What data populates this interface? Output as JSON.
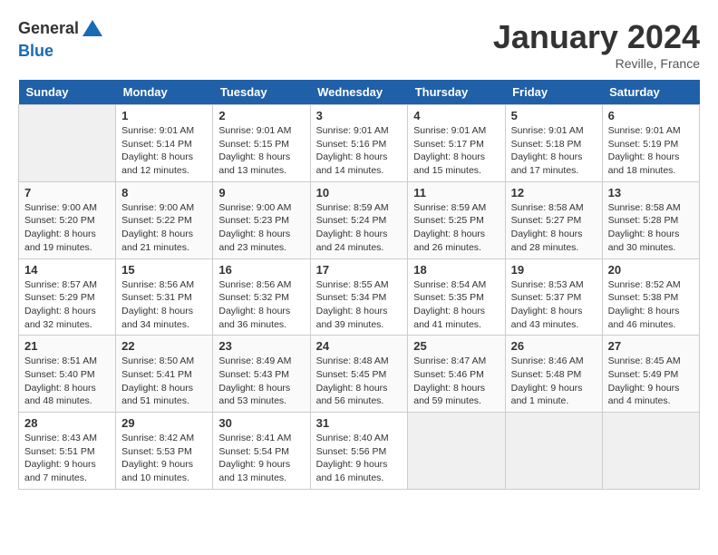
{
  "header": {
    "logo_general": "General",
    "logo_blue": "Blue",
    "month": "January 2024",
    "location": "Reville, France"
  },
  "weekdays": [
    "Sunday",
    "Monday",
    "Tuesday",
    "Wednesday",
    "Thursday",
    "Friday",
    "Saturday"
  ],
  "weeks": [
    [
      {
        "day": "",
        "empty": true
      },
      {
        "day": "1",
        "sunrise": "Sunrise: 9:01 AM",
        "sunset": "Sunset: 5:14 PM",
        "daylight": "Daylight: 8 hours and 12 minutes."
      },
      {
        "day": "2",
        "sunrise": "Sunrise: 9:01 AM",
        "sunset": "Sunset: 5:15 PM",
        "daylight": "Daylight: 8 hours and 13 minutes."
      },
      {
        "day": "3",
        "sunrise": "Sunrise: 9:01 AM",
        "sunset": "Sunset: 5:16 PM",
        "daylight": "Daylight: 8 hours and 14 minutes."
      },
      {
        "day": "4",
        "sunrise": "Sunrise: 9:01 AM",
        "sunset": "Sunset: 5:17 PM",
        "daylight": "Daylight: 8 hours and 15 minutes."
      },
      {
        "day": "5",
        "sunrise": "Sunrise: 9:01 AM",
        "sunset": "Sunset: 5:18 PM",
        "daylight": "Daylight: 8 hours and 17 minutes."
      },
      {
        "day": "6",
        "sunrise": "Sunrise: 9:01 AM",
        "sunset": "Sunset: 5:19 PM",
        "daylight": "Daylight: 8 hours and 18 minutes."
      }
    ],
    [
      {
        "day": "7",
        "sunrise": "Sunrise: 9:00 AM",
        "sunset": "Sunset: 5:20 PM",
        "daylight": "Daylight: 8 hours and 19 minutes."
      },
      {
        "day": "8",
        "sunrise": "Sunrise: 9:00 AM",
        "sunset": "Sunset: 5:22 PM",
        "daylight": "Daylight: 8 hours and 21 minutes."
      },
      {
        "day": "9",
        "sunrise": "Sunrise: 9:00 AM",
        "sunset": "Sunset: 5:23 PM",
        "daylight": "Daylight: 8 hours and 23 minutes."
      },
      {
        "day": "10",
        "sunrise": "Sunrise: 8:59 AM",
        "sunset": "Sunset: 5:24 PM",
        "daylight": "Daylight: 8 hours and 24 minutes."
      },
      {
        "day": "11",
        "sunrise": "Sunrise: 8:59 AM",
        "sunset": "Sunset: 5:25 PM",
        "daylight": "Daylight: 8 hours and 26 minutes."
      },
      {
        "day": "12",
        "sunrise": "Sunrise: 8:58 AM",
        "sunset": "Sunset: 5:27 PM",
        "daylight": "Daylight: 8 hours and 28 minutes."
      },
      {
        "day": "13",
        "sunrise": "Sunrise: 8:58 AM",
        "sunset": "Sunset: 5:28 PM",
        "daylight": "Daylight: 8 hours and 30 minutes."
      }
    ],
    [
      {
        "day": "14",
        "sunrise": "Sunrise: 8:57 AM",
        "sunset": "Sunset: 5:29 PM",
        "daylight": "Daylight: 8 hours and 32 minutes."
      },
      {
        "day": "15",
        "sunrise": "Sunrise: 8:56 AM",
        "sunset": "Sunset: 5:31 PM",
        "daylight": "Daylight: 8 hours and 34 minutes."
      },
      {
        "day": "16",
        "sunrise": "Sunrise: 8:56 AM",
        "sunset": "Sunset: 5:32 PM",
        "daylight": "Daylight: 8 hours and 36 minutes."
      },
      {
        "day": "17",
        "sunrise": "Sunrise: 8:55 AM",
        "sunset": "Sunset: 5:34 PM",
        "daylight": "Daylight: 8 hours and 39 minutes."
      },
      {
        "day": "18",
        "sunrise": "Sunrise: 8:54 AM",
        "sunset": "Sunset: 5:35 PM",
        "daylight": "Daylight: 8 hours and 41 minutes."
      },
      {
        "day": "19",
        "sunrise": "Sunrise: 8:53 AM",
        "sunset": "Sunset: 5:37 PM",
        "daylight": "Daylight: 8 hours and 43 minutes."
      },
      {
        "day": "20",
        "sunrise": "Sunrise: 8:52 AM",
        "sunset": "Sunset: 5:38 PM",
        "daylight": "Daylight: 8 hours and 46 minutes."
      }
    ],
    [
      {
        "day": "21",
        "sunrise": "Sunrise: 8:51 AM",
        "sunset": "Sunset: 5:40 PM",
        "daylight": "Daylight: 8 hours and 48 minutes."
      },
      {
        "day": "22",
        "sunrise": "Sunrise: 8:50 AM",
        "sunset": "Sunset: 5:41 PM",
        "daylight": "Daylight: 8 hours and 51 minutes."
      },
      {
        "day": "23",
        "sunrise": "Sunrise: 8:49 AM",
        "sunset": "Sunset: 5:43 PM",
        "daylight": "Daylight: 8 hours and 53 minutes."
      },
      {
        "day": "24",
        "sunrise": "Sunrise: 8:48 AM",
        "sunset": "Sunset: 5:45 PM",
        "daylight": "Daylight: 8 hours and 56 minutes."
      },
      {
        "day": "25",
        "sunrise": "Sunrise: 8:47 AM",
        "sunset": "Sunset: 5:46 PM",
        "daylight": "Daylight: 8 hours and 59 minutes."
      },
      {
        "day": "26",
        "sunrise": "Sunrise: 8:46 AM",
        "sunset": "Sunset: 5:48 PM",
        "daylight": "Daylight: 9 hours and 1 minute."
      },
      {
        "day": "27",
        "sunrise": "Sunrise: 8:45 AM",
        "sunset": "Sunset: 5:49 PM",
        "daylight": "Daylight: 9 hours and 4 minutes."
      }
    ],
    [
      {
        "day": "28",
        "sunrise": "Sunrise: 8:43 AM",
        "sunset": "Sunset: 5:51 PM",
        "daylight": "Daylight: 9 hours and 7 minutes."
      },
      {
        "day": "29",
        "sunrise": "Sunrise: 8:42 AM",
        "sunset": "Sunset: 5:53 PM",
        "daylight": "Daylight: 9 hours and 10 minutes."
      },
      {
        "day": "30",
        "sunrise": "Sunrise: 8:41 AM",
        "sunset": "Sunset: 5:54 PM",
        "daylight": "Daylight: 9 hours and 13 minutes."
      },
      {
        "day": "31",
        "sunrise": "Sunrise: 8:40 AM",
        "sunset": "Sunset: 5:56 PM",
        "daylight": "Daylight: 9 hours and 16 minutes."
      },
      {
        "day": "",
        "empty": true
      },
      {
        "day": "",
        "empty": true
      },
      {
        "day": "",
        "empty": true
      }
    ]
  ]
}
